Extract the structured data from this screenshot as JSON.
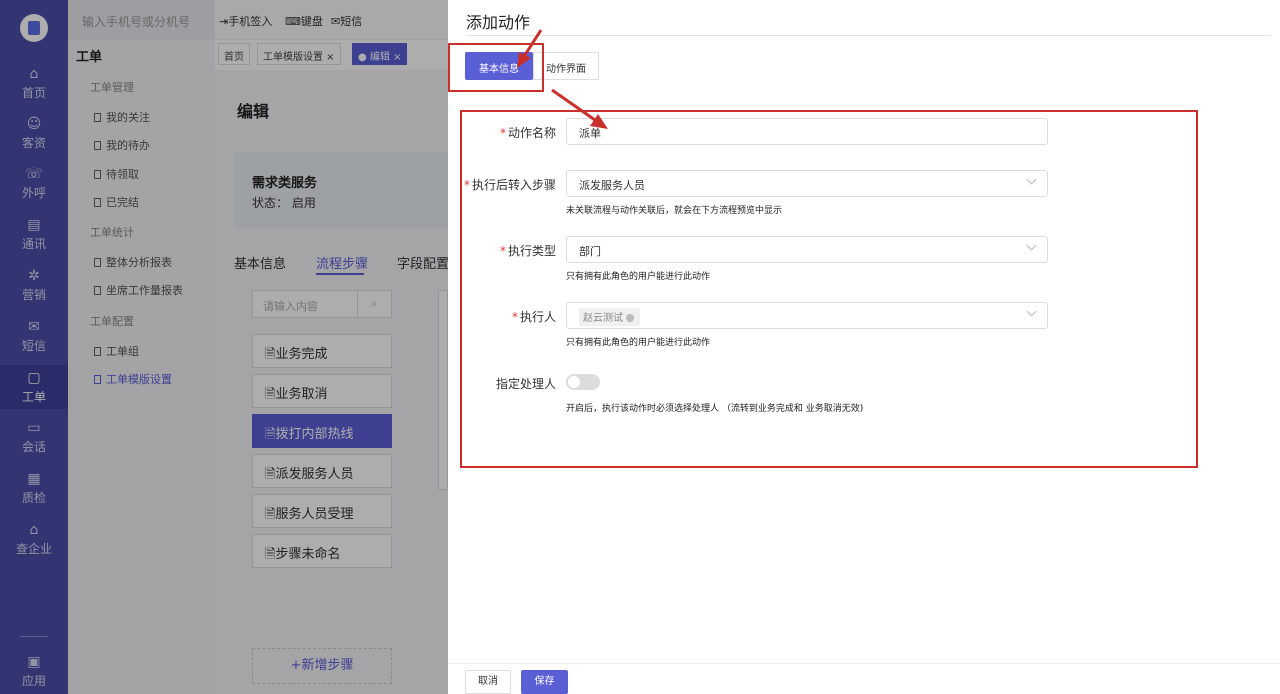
{
  "rail": {
    "items": [
      {
        "label": "首页",
        "icon": "home-icon"
      },
      {
        "label": "客资",
        "icon": "user-icon"
      },
      {
        "label": "外呼",
        "icon": "phone-icon"
      },
      {
        "label": "通讯",
        "icon": "contacts-icon"
      },
      {
        "label": "营销",
        "icon": "gear-icon"
      },
      {
        "label": "短信",
        "icon": "message-icon"
      },
      {
        "label": "工单",
        "icon": "clipboard-icon"
      },
      {
        "label": "会话",
        "icon": "chat-icon"
      },
      {
        "label": "质检",
        "icon": "calendar-icon"
      },
      {
        "label": "查企业",
        "icon": "building-icon"
      },
      {
        "label": "应用",
        "icon": "app-icon"
      }
    ]
  },
  "topbar": {
    "search_placeholder": "输入手机号或分机号",
    "signin_label": "手机签入",
    "keyboard_label": "键盘",
    "sms_label": "短信"
  },
  "subnav": {
    "title": "工单",
    "group1": "工单管理",
    "g1_items": [
      "我的关注",
      "我的待办",
      "待领取",
      "已完结"
    ],
    "group2": "工单统计",
    "g2_items": [
      "整体分析报表",
      "坐席工作量报表"
    ],
    "group3": "工单配置",
    "g3_items": [
      "工单组",
      "工单模版设置"
    ]
  },
  "page_tabs": {
    "home": "首页",
    "template": "工单模版设置 ×",
    "edit": "● 编辑 ×"
  },
  "main": {
    "edit_title": "编辑",
    "service_name": "需求类服务",
    "service_status": "状态：  启用",
    "tab_basic": "基本信息",
    "tab_flow": "流程步骤",
    "tab_field": "字段配置",
    "step_search_placeholder": "请输入内容",
    "steps": [
      "业务完成",
      "业务取消",
      "拨打内部热线",
      "派发服务人员",
      "服务人员受理",
      "步骤未命名"
    ],
    "add_step": "+新增步骤"
  },
  "drawer": {
    "title": "添加动作",
    "tab_basic": "基本信息",
    "tab_ui": "动作界面",
    "action_name_label": "动作名称",
    "action_name_value": "派单",
    "next_step_label": "执行后转入步骤",
    "next_step_value": "派发服务人员",
    "next_step_hint": "未关联流程与动作关联后，就会在下方流程预览中显示",
    "exec_type_label": "执行类型",
    "exec_type_value": "部门",
    "exec_type_hint": "只有拥有此角色的用户能进行此动作",
    "executor_label": "执行人",
    "executor_tag": "赵云测试",
    "executor_hint": "只有拥有此角色的用户能进行此动作",
    "handler_label": "指定处理人",
    "handler_enabled": false,
    "handler_hint": "开启后，执行该动作时必须选择处理人 （流转到业务完成和 业务取消无效)",
    "cancel": "取消",
    "save": "保存"
  },
  "colors": {
    "accent": "#5b5fd6",
    "rail": "#4a4fa8",
    "annotation": "#c9302c",
    "required": "#e03b3b"
  }
}
